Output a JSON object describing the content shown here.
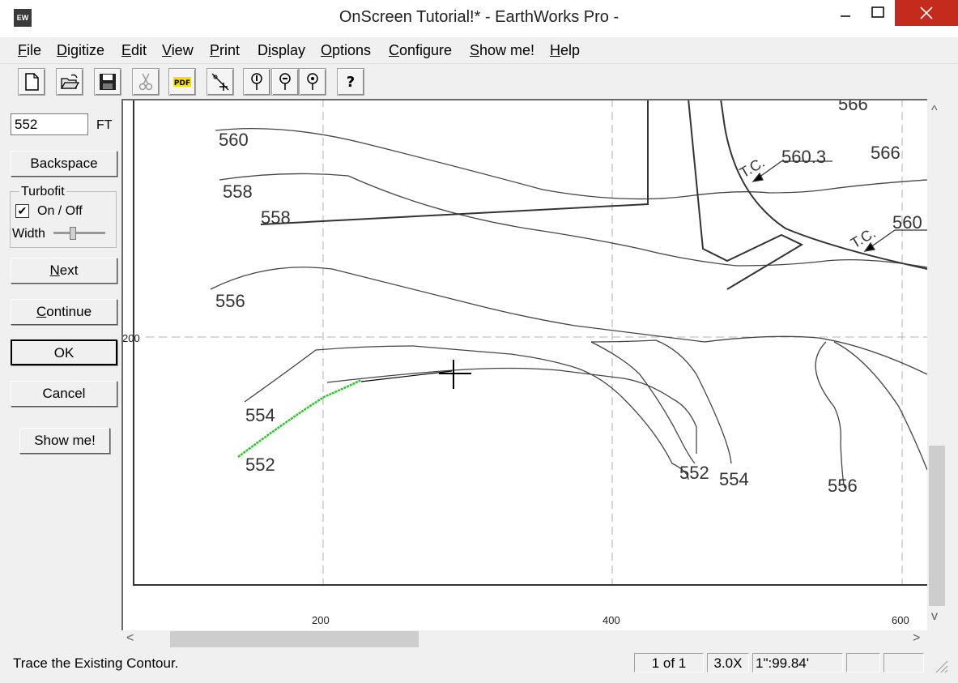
{
  "window": {
    "icon_text": "EW",
    "title": "OnScreen Tutorial!* - EarthWorks Pro -",
    "minimize": "—",
    "maximize": "☐",
    "close": "✕"
  },
  "menu": {
    "items": [
      {
        "u": "F",
        "rest": "ile"
      },
      {
        "u": "D",
        "rest": "igitize"
      },
      {
        "u": "E",
        "rest": "dit"
      },
      {
        "u": "V",
        "rest": "iew"
      },
      {
        "u": "P",
        "rest": "rint"
      },
      {
        "pre": "D",
        "u": "i",
        "rest": "splay"
      },
      {
        "u": "O",
        "rest": "ptions"
      },
      {
        "u": "C",
        "rest": "onfigure"
      },
      {
        "u": "S",
        "rest": "how me!"
      },
      {
        "u": "H",
        "rest": "elp"
      }
    ]
  },
  "toolbar": {
    "icons": [
      "new-file-icon",
      "open-folder-icon",
      "save-disk-icon",
      "cut-scissors-icon",
      "pdf-icon",
      "digitize-cursor-icon",
      "probe-1-icon",
      "probe-2-icon",
      "probe-3-icon",
      "help-question-icon"
    ],
    "pdf_text": "PDF",
    "help_text": "?"
  },
  "panel": {
    "elevation_value": "552",
    "unit": "FT",
    "backspace": "Backspace",
    "turbofit_label": "Turbofit",
    "turbofit_checked": true,
    "check_mark": "✔",
    "onoff": "On / Off",
    "width_label": "Width",
    "next_u": "N",
    "next_rest": "ext",
    "continue_u": "C",
    "continue_rest": "ontinue",
    "ok": "OK",
    "cancel": "Cancel",
    "showme": "Show me!"
  },
  "drawing": {
    "labels": {
      "l560": "560",
      "l558a": "558",
      "l558b": "558",
      "l556": "556",
      "l554": "554",
      "l552": "552",
      "l552r": "552",
      "l554r": "554",
      "l556r": "556",
      "l566a": "566",
      "l566b": "566",
      "tc1": "T.C.",
      "tc1v": "560.3",
      "tc2": "T.C.",
      "tc2v": "560",
      "grid200y": "200"
    },
    "trace_color": "#22cc22"
  },
  "axis": {
    "x200": "200",
    "x400": "400",
    "x600": "600"
  },
  "scroll": {
    "up": "^",
    "down": "v",
    "left": "<",
    "right": ">"
  },
  "status": {
    "message": "Trace the Existing Contour.",
    "page": "1 of 1",
    "zoom": "3.0X",
    "scale": "1\":99.84'"
  }
}
